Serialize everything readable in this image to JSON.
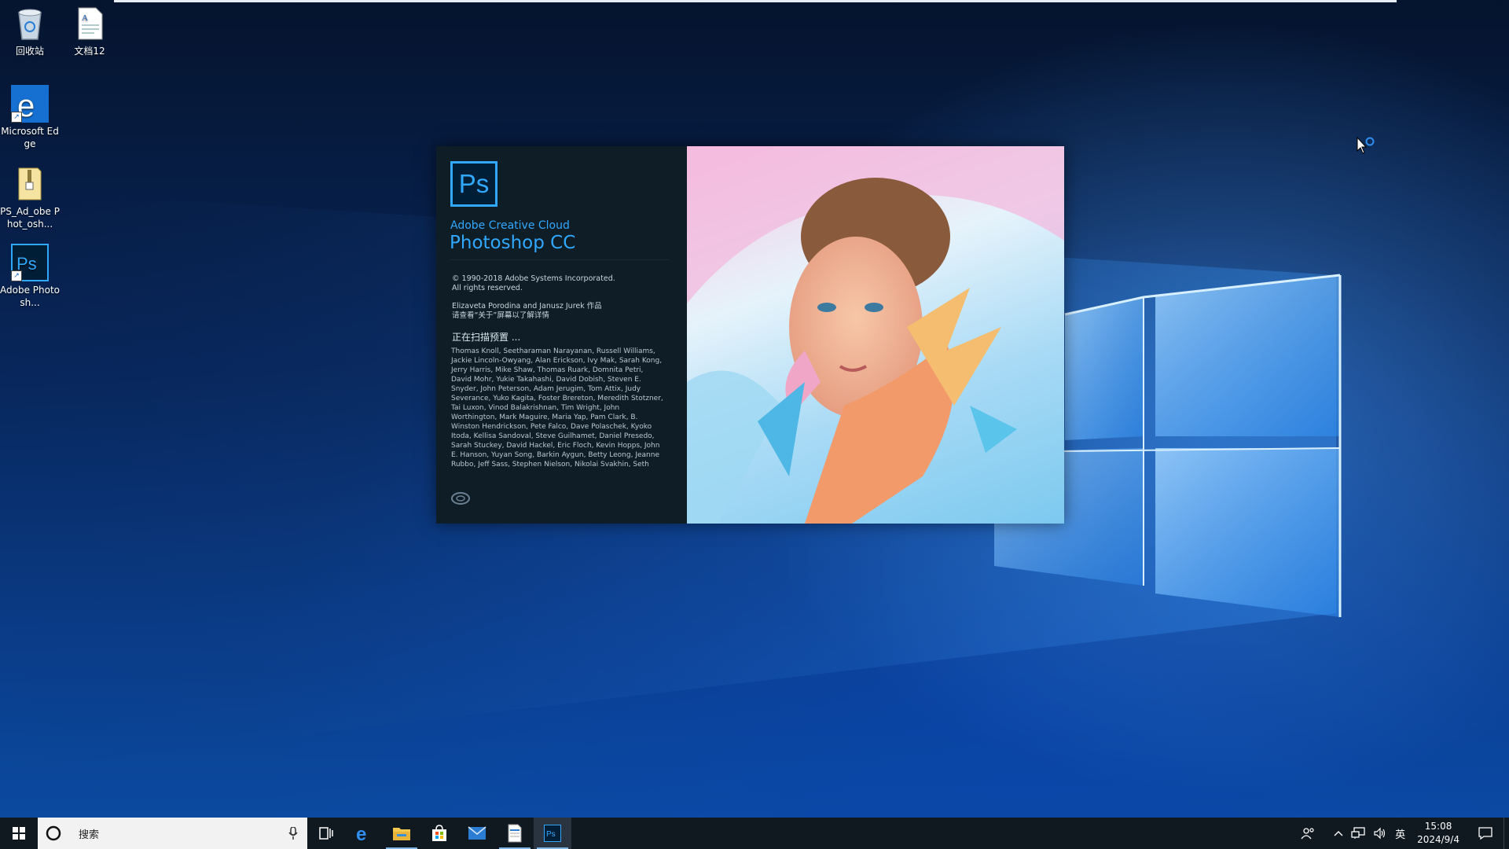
{
  "desktop": {
    "icons": [
      {
        "label": "回收站",
        "icon": "recycle-bin-icon"
      },
      {
        "label": "文档12",
        "icon": "document-icon"
      },
      {
        "label": "Microsoft Edge",
        "icon": "edge-icon"
      },
      {
        "label": "PS_Ad_obe Phot_osh...",
        "icon": "zip-folder-icon"
      },
      {
        "label": "Adobe Photosh...",
        "icon": "photoshop-icon"
      }
    ]
  },
  "splash": {
    "logo_text": "Ps",
    "suite_name": "Adobe Creative Cloud",
    "app_name": "Photoshop CC",
    "copyright": "© 1990-2018 Adobe Systems Incorporated.\nAll rights reserved.",
    "artwork_credit": "Elizaveta Porodina and Janusz Jurek 作品\n请查看“关于”屏幕以了解详情",
    "status": "正在扫描预置 ...",
    "credits": "Thomas Knoll, Seetharaman Narayanan, Russell Williams, Jackie Lincoln-Owyang, Alan Erickson, Ivy Mak, Sarah Kong, Jerry Harris, Mike Shaw, Thomas Ruark, Domnita Petri, David Mohr, Yukie Takahashi, David Dobish, Steven E. Snyder, John Peterson, Adam Jerugim, Tom Attix, Judy Severance, Yuko Kagita, Foster Brereton, Meredith Stotzner, Tai Luxon, Vinod Balakrishnan, Tim Wright, John Worthington, Mark Maguire, Maria Yap, Pam Clark, B. Winston Hendrickson, Pete Falco, Dave Polaschek, Kyoko Itoda, Kellisa Sandoval, Steve Guilhamet, Daniel Presedo, Sarah Stuckey, David Hackel, Eric Floch, Kevin Hopps, John E. Hanson, Yuyan Song, Barkin Aygun, Betty Leong, Jeanne Rubbo, Jeff Sass, Stephen Nielson, Nikolai Svakhin, Seth"
  },
  "taskbar": {
    "search_placeholder": "搜索",
    "ime_label": "英",
    "time": "15:08",
    "date": "2024/9/4"
  },
  "colors": {
    "ps_blue": "#31a8ff",
    "splash_panel": "#0f1d26",
    "taskbar": "#101820"
  }
}
